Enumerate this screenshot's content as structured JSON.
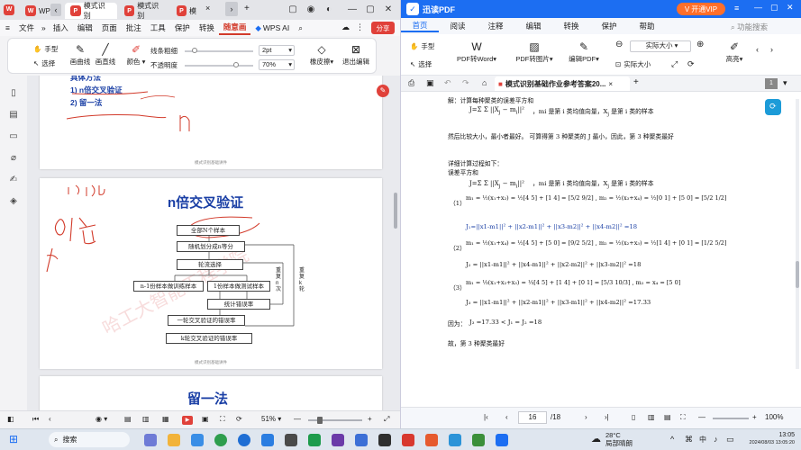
{
  "left_app": {
    "tabs": [
      {
        "label": "WPS"
      },
      {
        "label": "模式识别"
      },
      {
        "label": "模式识别"
      },
      {
        "label": "模"
      }
    ],
    "menu": [
      "文件",
      "插入",
      "编辑",
      "页面",
      "批注",
      "工具",
      "保护",
      "转换",
      "随意画",
      "WPS AI"
    ],
    "share_label": "分享",
    "toolbar": {
      "hand": "手型",
      "select": "选择",
      "pen": "画曲线",
      "line": "画直线",
      "color": "颜色",
      "line_width": "线条粗细",
      "opacity": "不透明度",
      "width_value": "2pt",
      "opacity_value": "70%",
      "eraser": "橡皮擦",
      "exit": "退出编辑"
    },
    "page1": {
      "heading": "具体方法",
      "items": [
        "1) n倍交叉验证",
        "2) 留一法"
      ],
      "footer": "模式识别基础讲件"
    },
    "page2": {
      "title": "n倍交叉验证",
      "boxes": [
        "全部N个样本",
        "随机划分成n等分",
        "轮流选择",
        "n-1份样本做训练样本",
        "1份样本做测试样本",
        "统计错误率",
        "一轮交叉验证的错误率",
        "k轮交叉验证的错误率"
      ],
      "side_labels": [
        "重复n次",
        "重复k轮"
      ],
      "watermark": "哈工大智能工程学院",
      "footer": "模式识别基础讲件"
    },
    "page3": {
      "title": "留一法"
    },
    "status": {
      "zoom": "51%"
    }
  },
  "right_app": {
    "app_title": "迅读PDF",
    "vip_label": "开通VIP",
    "menu": [
      "首页",
      "阅读",
      "注释",
      "编辑",
      "转换",
      "保护",
      "帮助"
    ],
    "search_label": "功能搜索",
    "toolbar": {
      "hand": "手型",
      "select": "选择",
      "pdf_word": "PDF转Word",
      "pdf_img": "PDF转图片",
      "edit_pdf": "编辑PDF",
      "actual_size": "实际大小",
      "actual_size2": "实际大小",
      "bright": "高亮"
    },
    "tab_title": "模式识别基础作业参考答案20...",
    "tab_page_badge": "1",
    "doc": {
      "l1": "解：计算每种聚类的误差平方和",
      "l2_tail": "，mi 是第 i 类均值向量，X",
      "l2_tail2": "是第 i 类的样本",
      "l3": "然后比较大小，最小者最好。 可算得第 3 种聚类的 J 最小，因此，第 3 种聚类最好",
      "l4": "详细计算过程如下：",
      "l5": "误差平方和",
      "l6_tail": "，mi 是第 i 类均值向量，X",
      "l6_tail2": "是第 i 类的样本",
      "c1": "（1）",
      "c2": "（2）",
      "c3": "（3）",
      "j1": "J₁=||x1-m1||² + ||x2-m1||² + ||x3-m2||² + ||x4-m2||² =18",
      "j2": "J₂ = ||x1-m1||² + ||x4-m1||² + ||x2-m2||² + ||x3-m2||² =18",
      "j3": "J₃ = ||x1-m1||² + ||x2-m1||² + ||x3-m1||² + ||x4-m2||² =17.33",
      "because": "因为：",
      "because_expr": "J₃ =17.33 < J₁ = J₂ =18",
      "conclusion": "故，第 3 种聚类最好"
    },
    "status": {
      "page": "16",
      "total": "/18",
      "zoom": "100%"
    }
  },
  "taskbar": {
    "search": "搜索",
    "weather_temp": "28°C",
    "weather_desc": "局部晴朗",
    "time": "13:05",
    "date": "2024/08/03 13:05:20",
    "lang": "中"
  }
}
